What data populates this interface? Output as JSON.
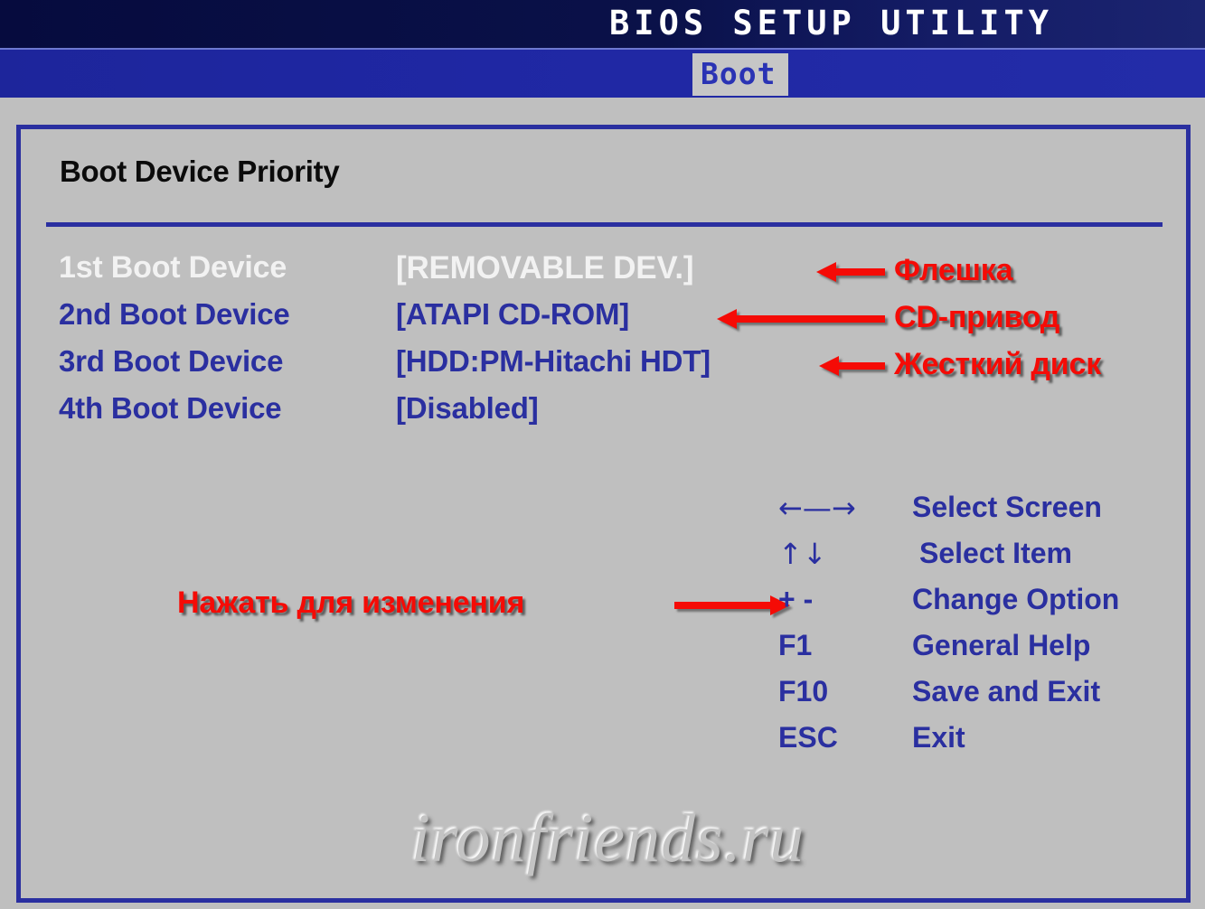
{
  "titlebar": {
    "title": "BIOS SETUP UTILITY"
  },
  "tabbar": {
    "active_tab": "Boot",
    "tabs": [
      "Boot"
    ]
  },
  "main": {
    "section_title": "Boot Device Priority",
    "boot_devices": [
      {
        "label": "1st Boot Device",
        "value": "[REMOVABLE DEV.]",
        "selected": true
      },
      {
        "label": "2nd Boot Device",
        "value": "[ATAPI CD-ROM]",
        "selected": false
      },
      {
        "label": "3rd Boot Device",
        "value": "[HDD:PM-Hitachi HDT]",
        "selected": false
      },
      {
        "label": "4th Boot Device",
        "value": "[Disabled]",
        "selected": false
      }
    ]
  },
  "annotations": {
    "flash_drive": "Флешка",
    "cd_drive": "CD-привод",
    "hard_disk": "Жесткий диск",
    "press_to_change": "Нажать для изменения"
  },
  "legend": {
    "items": [
      {
        "key": "←—→",
        "desc": "Select Screen",
        "glyph": true
      },
      {
        "key": "↑↓",
        "desc": "Select Item",
        "glyph": true
      },
      {
        "key": "+ -",
        "desc": "Change Option",
        "glyph": false
      },
      {
        "key": "F1",
        "desc": "General Help",
        "glyph": false
      },
      {
        "key": "F10",
        "desc": "Save and Exit",
        "glyph": false
      },
      {
        "key": "ESC",
        "desc": "Exit",
        "glyph": false
      }
    ]
  },
  "watermark": {
    "text": "ironfriends.ru"
  },
  "colors": {
    "background": "#bfbfbf",
    "blue": "#2a2fa0",
    "title_navy": "#0a1149",
    "tab_blue": "#1f27a3",
    "selected_white": "#f2f2f2",
    "annotation_red": "#f50b06"
  }
}
